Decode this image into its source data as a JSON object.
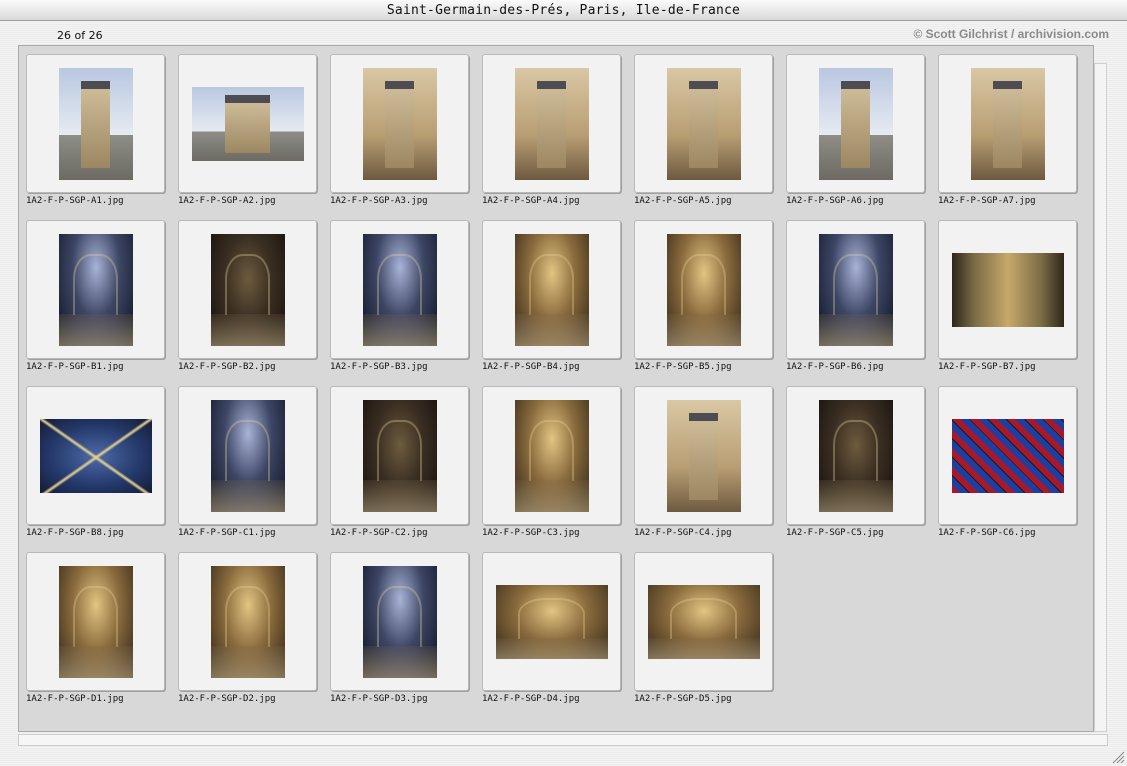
{
  "window": {
    "title": "Saint-Germain-des-Prés, Paris, Ile-de-France"
  },
  "header": {
    "count": "26 of 26",
    "credit": "© Scott Gilchrist / archivision.com"
  },
  "thumbnails": [
    {
      "caption": "1A2-F-P-SGP-A1.jpg",
      "orientation": "portrait",
      "style": "sky"
    },
    {
      "caption": "1A2-F-P-SGP-A2.jpg",
      "orientation": "landscape",
      "style": "sky"
    },
    {
      "caption": "1A2-F-P-SGP-A3.jpg",
      "orientation": "portrait",
      "style": "stone"
    },
    {
      "caption": "1A2-F-P-SGP-A4.jpg",
      "orientation": "portrait",
      "style": "stone"
    },
    {
      "caption": "1A2-F-P-SGP-A5.jpg",
      "orientation": "portrait",
      "style": "stone"
    },
    {
      "caption": "1A2-F-P-SGP-A6.jpg",
      "orientation": "portrait",
      "style": "sky"
    },
    {
      "caption": "1A2-F-P-SGP-A7.jpg",
      "orientation": "portrait",
      "style": "stone"
    },
    {
      "caption": "1A2-F-P-SGP-B1.jpg",
      "orientation": "portrait",
      "style": "nave-blue"
    },
    {
      "caption": "1A2-F-P-SGP-B2.jpg",
      "orientation": "portrait",
      "style": "nave-dark"
    },
    {
      "caption": "1A2-F-P-SGP-B3.jpg",
      "orientation": "portrait",
      "style": "nave-blue"
    },
    {
      "caption": "1A2-F-P-SGP-B4.jpg",
      "orientation": "portrait",
      "style": "nave-gold"
    },
    {
      "caption": "1A2-F-P-SGP-B5.jpg",
      "orientation": "portrait",
      "style": "nave-gold"
    },
    {
      "caption": "1A2-F-P-SGP-B6.jpg",
      "orientation": "portrait",
      "style": "nave-blue"
    },
    {
      "caption": "1A2-F-P-SGP-B7.jpg",
      "orientation": "landscape",
      "style": "capital"
    },
    {
      "caption": "1A2-F-P-SGP-B8.jpg",
      "orientation": "landscape",
      "style": "ceiling"
    },
    {
      "caption": "1A2-F-P-SGP-C1.jpg",
      "orientation": "portrait",
      "style": "nave-blue"
    },
    {
      "caption": "1A2-F-P-SGP-C2.jpg",
      "orientation": "portrait",
      "style": "nave-dark"
    },
    {
      "caption": "1A2-F-P-SGP-C3.jpg",
      "orientation": "portrait",
      "style": "nave-gold"
    },
    {
      "caption": "1A2-F-P-SGP-C4.jpg",
      "orientation": "portrait",
      "style": "stone"
    },
    {
      "caption": "1A2-F-P-SGP-C5.jpg",
      "orientation": "portrait",
      "style": "nave-dark"
    },
    {
      "caption": "1A2-F-P-SGP-C6.jpg",
      "orientation": "landscape",
      "style": "window-glass"
    },
    {
      "caption": "1A2-F-P-SGP-D1.jpg",
      "orientation": "portrait",
      "style": "nave-gold"
    },
    {
      "caption": "1A2-F-P-SGP-D2.jpg",
      "orientation": "portrait",
      "style": "nave-gold"
    },
    {
      "caption": "1A2-F-P-SGP-D3.jpg",
      "orientation": "portrait",
      "style": "nave-blue"
    },
    {
      "caption": "1A2-F-P-SGP-D4.jpg",
      "orientation": "landscape",
      "style": "nave-gold"
    },
    {
      "caption": "1A2-F-P-SGP-D5.jpg",
      "orientation": "landscape",
      "style": "nave-gold"
    }
  ]
}
